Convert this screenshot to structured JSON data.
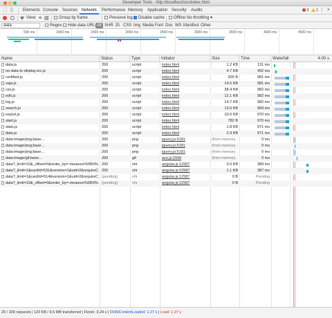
{
  "window": {
    "title": "Developer Tools - http://localhost/src/index.html"
  },
  "tabs": [
    "Elements",
    "Console",
    "Sources",
    "Network",
    "Performance",
    "Memory",
    "Application",
    "Security",
    "Audits"
  ],
  "active_tab": "Network",
  "badges": {
    "errors": "3",
    "warnings": "1"
  },
  "toolbar": {
    "view_label": "View:",
    "group_by_frame": "Group by frame",
    "preserve_log": "Preserve log",
    "disable_cache": "Disable cache",
    "offline": "Offline",
    "throttling": "No throttling"
  },
  "filterbar": {
    "filter_value": "data",
    "regex": "Regex",
    "hide_data_urls": "Hide data URLs",
    "types": [
      "All",
      "XHR",
      "JS",
      "CSS",
      "Img",
      "Media",
      "Font",
      "Doc",
      "WS",
      "Manifest",
      "Other"
    ],
    "selected_type": "All"
  },
  "overview": {
    "ticks": [
      "500 ms",
      "1000 ms",
      "1500 ms",
      "2000 ms",
      "2500 ms",
      "3000 ms",
      "3500 ms",
      "4000 ms",
      "4500 ms"
    ]
  },
  "columns": {
    "name": "Name",
    "status": "Status",
    "type": "Type",
    "initiator": "Initiator",
    "size": "Size",
    "time": "Time",
    "waterfall": "Waterfall",
    "waterfall_scale": "4.00 s"
  },
  "requests": [
    {
      "name": "data.js",
      "status": "200",
      "type": "script",
      "initiator": "index.html",
      "size": "1.2 KB",
      "time": "131 ms",
      "wf_start": 0.01,
      "wf_wait": 0.0,
      "wf_dl": 0.03,
      "wf_color": "#23c48e"
    },
    {
      "name": "no-data-to-display.src.js",
      "status": "200",
      "type": "script",
      "initiator": "index.html",
      "size": "4.7 KB",
      "time": "492 ms",
      "wf_start": 0.02,
      "wf_wait": 0.08,
      "wf_dl": 0.04,
      "wf_color": "#23c48e"
    },
    {
      "name": "certified.js",
      "status": "200",
      "type": "script",
      "initiator": "index.html",
      "size": "926 B",
      "time": "981 ms",
      "wf_start": 0.03,
      "wf_wait": 0.68,
      "wf_dl": 0.2,
      "wf_color": "#1aa3d0"
    },
    {
      "name": "xapi.js",
      "status": "200",
      "type": "script",
      "initiator": "index.html",
      "size": "14.5 KB",
      "time": "981 ms",
      "wf_start": 0.03,
      "wf_wait": 0.68,
      "wf_dl": 0.2,
      "wf_color": "#1aa3d0"
    },
    {
      "name": "csv.js",
      "status": "200",
      "type": "script",
      "initiator": "index.html",
      "size": "38.4 KB",
      "time": "982 ms",
      "wf_start": 0.03,
      "wf_wait": 0.68,
      "wf_dl": 0.2,
      "wf_color": "#1aa3d0"
    },
    {
      "name": "edit.js",
      "status": "200",
      "type": "script",
      "initiator": "index.html",
      "size": "12.1 KB",
      "time": "982 ms",
      "wf_start": 0.03,
      "wf_wait": 0.68,
      "wf_dl": 0.2,
      "wf_color": "#1aa3d0"
    },
    {
      "name": "log.js",
      "status": "200",
      "type": "script",
      "initiator": "index.html",
      "size": "14.7 KB",
      "time": "982 ms",
      "wf_start": 0.03,
      "wf_wait": 0.68,
      "wf_dl": 0.2,
      "wf_color": "#1aa3d0"
    },
    {
      "name": "search.js",
      "status": "200",
      "type": "script",
      "initiator": "index.html",
      "size": "13.5 KB",
      "time": "969 ms",
      "wf_start": 0.03,
      "wf_wait": 0.68,
      "wf_dl": 0.2,
      "wf_color": "#1aa3d0"
    },
    {
      "name": "export.js",
      "status": "200",
      "type": "script",
      "initiator": "index.html",
      "size": "10.6 KB",
      "time": "970 ms",
      "wf_start": 0.03,
      "wf_wait": 0.68,
      "wf_dl": 0.2,
      "wf_color": "#1aa3d0"
    },
    {
      "name": "start.js",
      "status": "200",
      "type": "script",
      "initiator": "index.html",
      "size": "782 B",
      "time": "970 ms",
      "wf_start": 0.03,
      "wf_wait": 0.68,
      "wf_dl": 0.2,
      "wf_color": "#1aa3d0"
    },
    {
      "name": "stats.js",
      "status": "200",
      "type": "script",
      "initiator": "index.html",
      "size": "1.8 KB",
      "time": "971 ms",
      "wf_start": 0.03,
      "wf_wait": 0.68,
      "wf_dl": 0.2,
      "wf_color": "#1aa3d0"
    },
    {
      "name": "data.js",
      "status": "200",
      "type": "script",
      "initiator": "index.html",
      "size": "2.9 KB",
      "time": "971 ms",
      "wf_start": 0.03,
      "wf_wait": 0.68,
      "wf_dl": 0.2,
      "wf_color": "#1aa3d0"
    },
    {
      "name": "data:image/png;base…",
      "status": "200",
      "type": "png",
      "initiator": "jquery.js:6181",
      "size": "(from memory …",
      "time": "0 ms",
      "wf_start": 0.38,
      "wf_wait": 0.0,
      "wf_dl": 0.0,
      "wf_color": "#1aa3d0",
      "memory": true
    },
    {
      "name": "data:image/png;base…",
      "status": "200",
      "type": "png",
      "initiator": "jquery.js:6181",
      "size": "(from memory …",
      "time": "0 ms",
      "wf_start": 0.38,
      "wf_wait": 0.0,
      "wf_dl": 0.0,
      "wf_color": "#1aa3d0",
      "memory": true
    },
    {
      "name": "data:image/png;base…",
      "status": "200",
      "type": "png",
      "initiator": "jquery.js:6181",
      "size": "(from memory …",
      "time": "0 ms",
      "wf_start": 0.38,
      "wf_wait": 0.0,
      "wf_dl": 0.0,
      "wf_color": "#1aa3d0",
      "memory": true
    },
    {
      "name": "data:image/gif;base…",
      "status": "200",
      "type": "gif",
      "initiator": "ace.js:2949",
      "size": "(from memory …",
      "time": "0 ms",
      "wf_start": 0.42,
      "wf_wait": 0.0,
      "wf_dl": 0.0,
      "wf_color": "#1aa3d0",
      "memory": true
    },
    {
      "name": "data?_limit=10&_offset=0&order_by=-measure%5B0%…",
      "status": "200",
      "type": "xhr",
      "initiator": "angular.js:12587",
      "size": "3.0 KB",
      "time": "389 ms",
      "wf_start": 0.58,
      "wf_wait": 0.0,
      "wf_dl": 0.17,
      "wf_color": "#1aa3d0"
    },
    {
      "name": "data?_limit=1&cardId=531&version=1&uid=2&requireC…",
      "status": "200",
      "type": "xhr",
      "initiator": "angular.js:12587",
      "size": "1.1 KB",
      "time": "387 ms",
      "wf_start": 0.58,
      "wf_wait": 0.0,
      "wf_dl": 0.17,
      "wf_color": "#1aa3d0"
    },
    {
      "name": "data?_limit=1&cardId=514&version=1&uid=2&requireC…",
      "status": "(pending)",
      "type": "xhr",
      "initiator": "angular.js:12587",
      "size": "0 B",
      "time": "Pending",
      "wf_start": 0.0,
      "wf_wait": 0.0,
      "wf_dl": 0.0,
      "wf_color": "#1aa3d0",
      "pending": true
    },
    {
      "name": "data?_limit=10&_offset=0&order_by=-measure%5B0%…",
      "status": "(pending)",
      "type": "xhr",
      "initiator": "angular.js:12587",
      "size": "0 B",
      "time": "Pending",
      "wf_start": 0.0,
      "wf_wait": 0.0,
      "wf_dl": 0.0,
      "wf_color": "#1aa3d0",
      "pending": true
    }
  ],
  "status": {
    "summary": "20 / 300 requests | 120 KB / 9.5 MB transferred | Finish: 3.24 s |",
    "dcl": "DOMContentLoaded: 1.27 s",
    "sep": "|",
    "load": "Load: 1.27 s"
  }
}
